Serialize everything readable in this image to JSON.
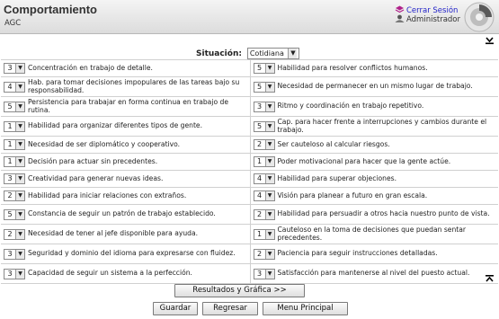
{
  "header": {
    "title": "Comportamiento",
    "subtitle": "AGC",
    "logout_label": "Cerrar Sesión",
    "user_label": "Administrador"
  },
  "situation": {
    "label": "Situación:",
    "value": "Cotidiana"
  },
  "rows": [
    [
      {
        "value": "3",
        "label": "Concentración en trabajo de detalle."
      },
      {
        "value": "5",
        "label": "Habilidad para resolver conflictos humanos."
      }
    ],
    [
      {
        "value": "4",
        "label": "Hab. para tomar decisiones impopulares de las tareas bajo su responsabilidad."
      },
      {
        "value": "5",
        "label": "Necesidad de permanecer en un mismo lugar de trabajo."
      }
    ],
    [
      {
        "value": "5",
        "label": "Persistencia para trabajar en forma continua en trabajo de rutina."
      },
      {
        "value": "3",
        "label": "Ritmo y coordinación en trabajo repetitivo."
      }
    ],
    [
      {
        "value": "1",
        "label": "Habilidad para organizar diferentes tipos de gente."
      },
      {
        "value": "5",
        "label": "Cap. para hacer frente a interrupciones y cambios durante el trabajo."
      }
    ],
    [
      {
        "value": "1",
        "label": "Necesidad de ser diplomático y cooperativo."
      },
      {
        "value": "2",
        "label": "Ser cauteloso al calcular riesgos."
      }
    ],
    [
      {
        "value": "1",
        "label": "Decisión para actuar sin precedentes."
      },
      {
        "value": "1",
        "label": "Poder motivacional para hacer que la gente actúe."
      }
    ],
    [
      {
        "value": "3",
        "label": "Creatividad para generar nuevas ideas."
      },
      {
        "value": "4",
        "label": "Habilidad para superar objeciones."
      }
    ],
    [
      {
        "value": "2",
        "label": "Habilidad para iniciar relaciones con extraños."
      },
      {
        "value": "4",
        "label": "Visión para planear a futuro en gran escala."
      }
    ],
    [
      {
        "value": "5",
        "label": "Constancia de seguir un patrón de trabajo establecido."
      },
      {
        "value": "2",
        "label": "Habilidad para persuadir a otros hacia nuestro punto de vista."
      }
    ],
    [
      {
        "value": "2",
        "label": "Necesidad de tener al jefe disponible para ayuda."
      },
      {
        "value": "1",
        "label": "Cauteloso en la toma de decisiones que puedan sentar precedentes."
      }
    ],
    [
      {
        "value": "3",
        "label": "Seguridad y dominio del idioma para expresarse con fluidez."
      },
      {
        "value": "2",
        "label": "Paciencia para seguir instrucciones detalladas."
      }
    ],
    [
      {
        "value": "3",
        "label": "Capacidad de seguir un sistema a la perfección."
      },
      {
        "value": "3",
        "label": "Satisfacción para mantenerse al nivel del puesto actual."
      }
    ]
  ],
  "buttons": {
    "results": "Resultados y Gráfica >>",
    "save": "Guardar",
    "back": "Regresar",
    "menu": "Menu Principal"
  }
}
